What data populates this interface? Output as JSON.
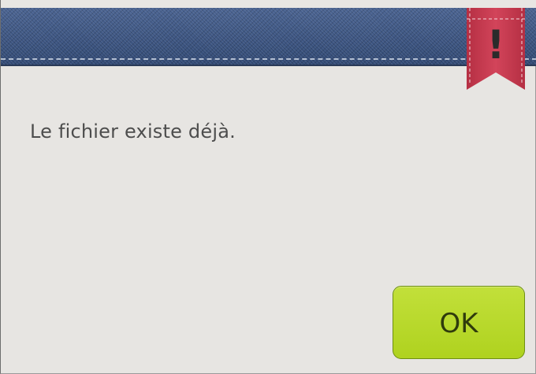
{
  "dialog": {
    "message": "Le fichier existe déjà.",
    "ok_label": "OK",
    "alert_glyph": "!",
    "alert_icon": "exclamation-ribbon-icon"
  },
  "colors": {
    "header_blue": "#3e5683",
    "ribbon_red": "#c8394e",
    "button_green": "#b7d82a",
    "background": "#e7e5e2",
    "text": "#4d4d4d"
  }
}
